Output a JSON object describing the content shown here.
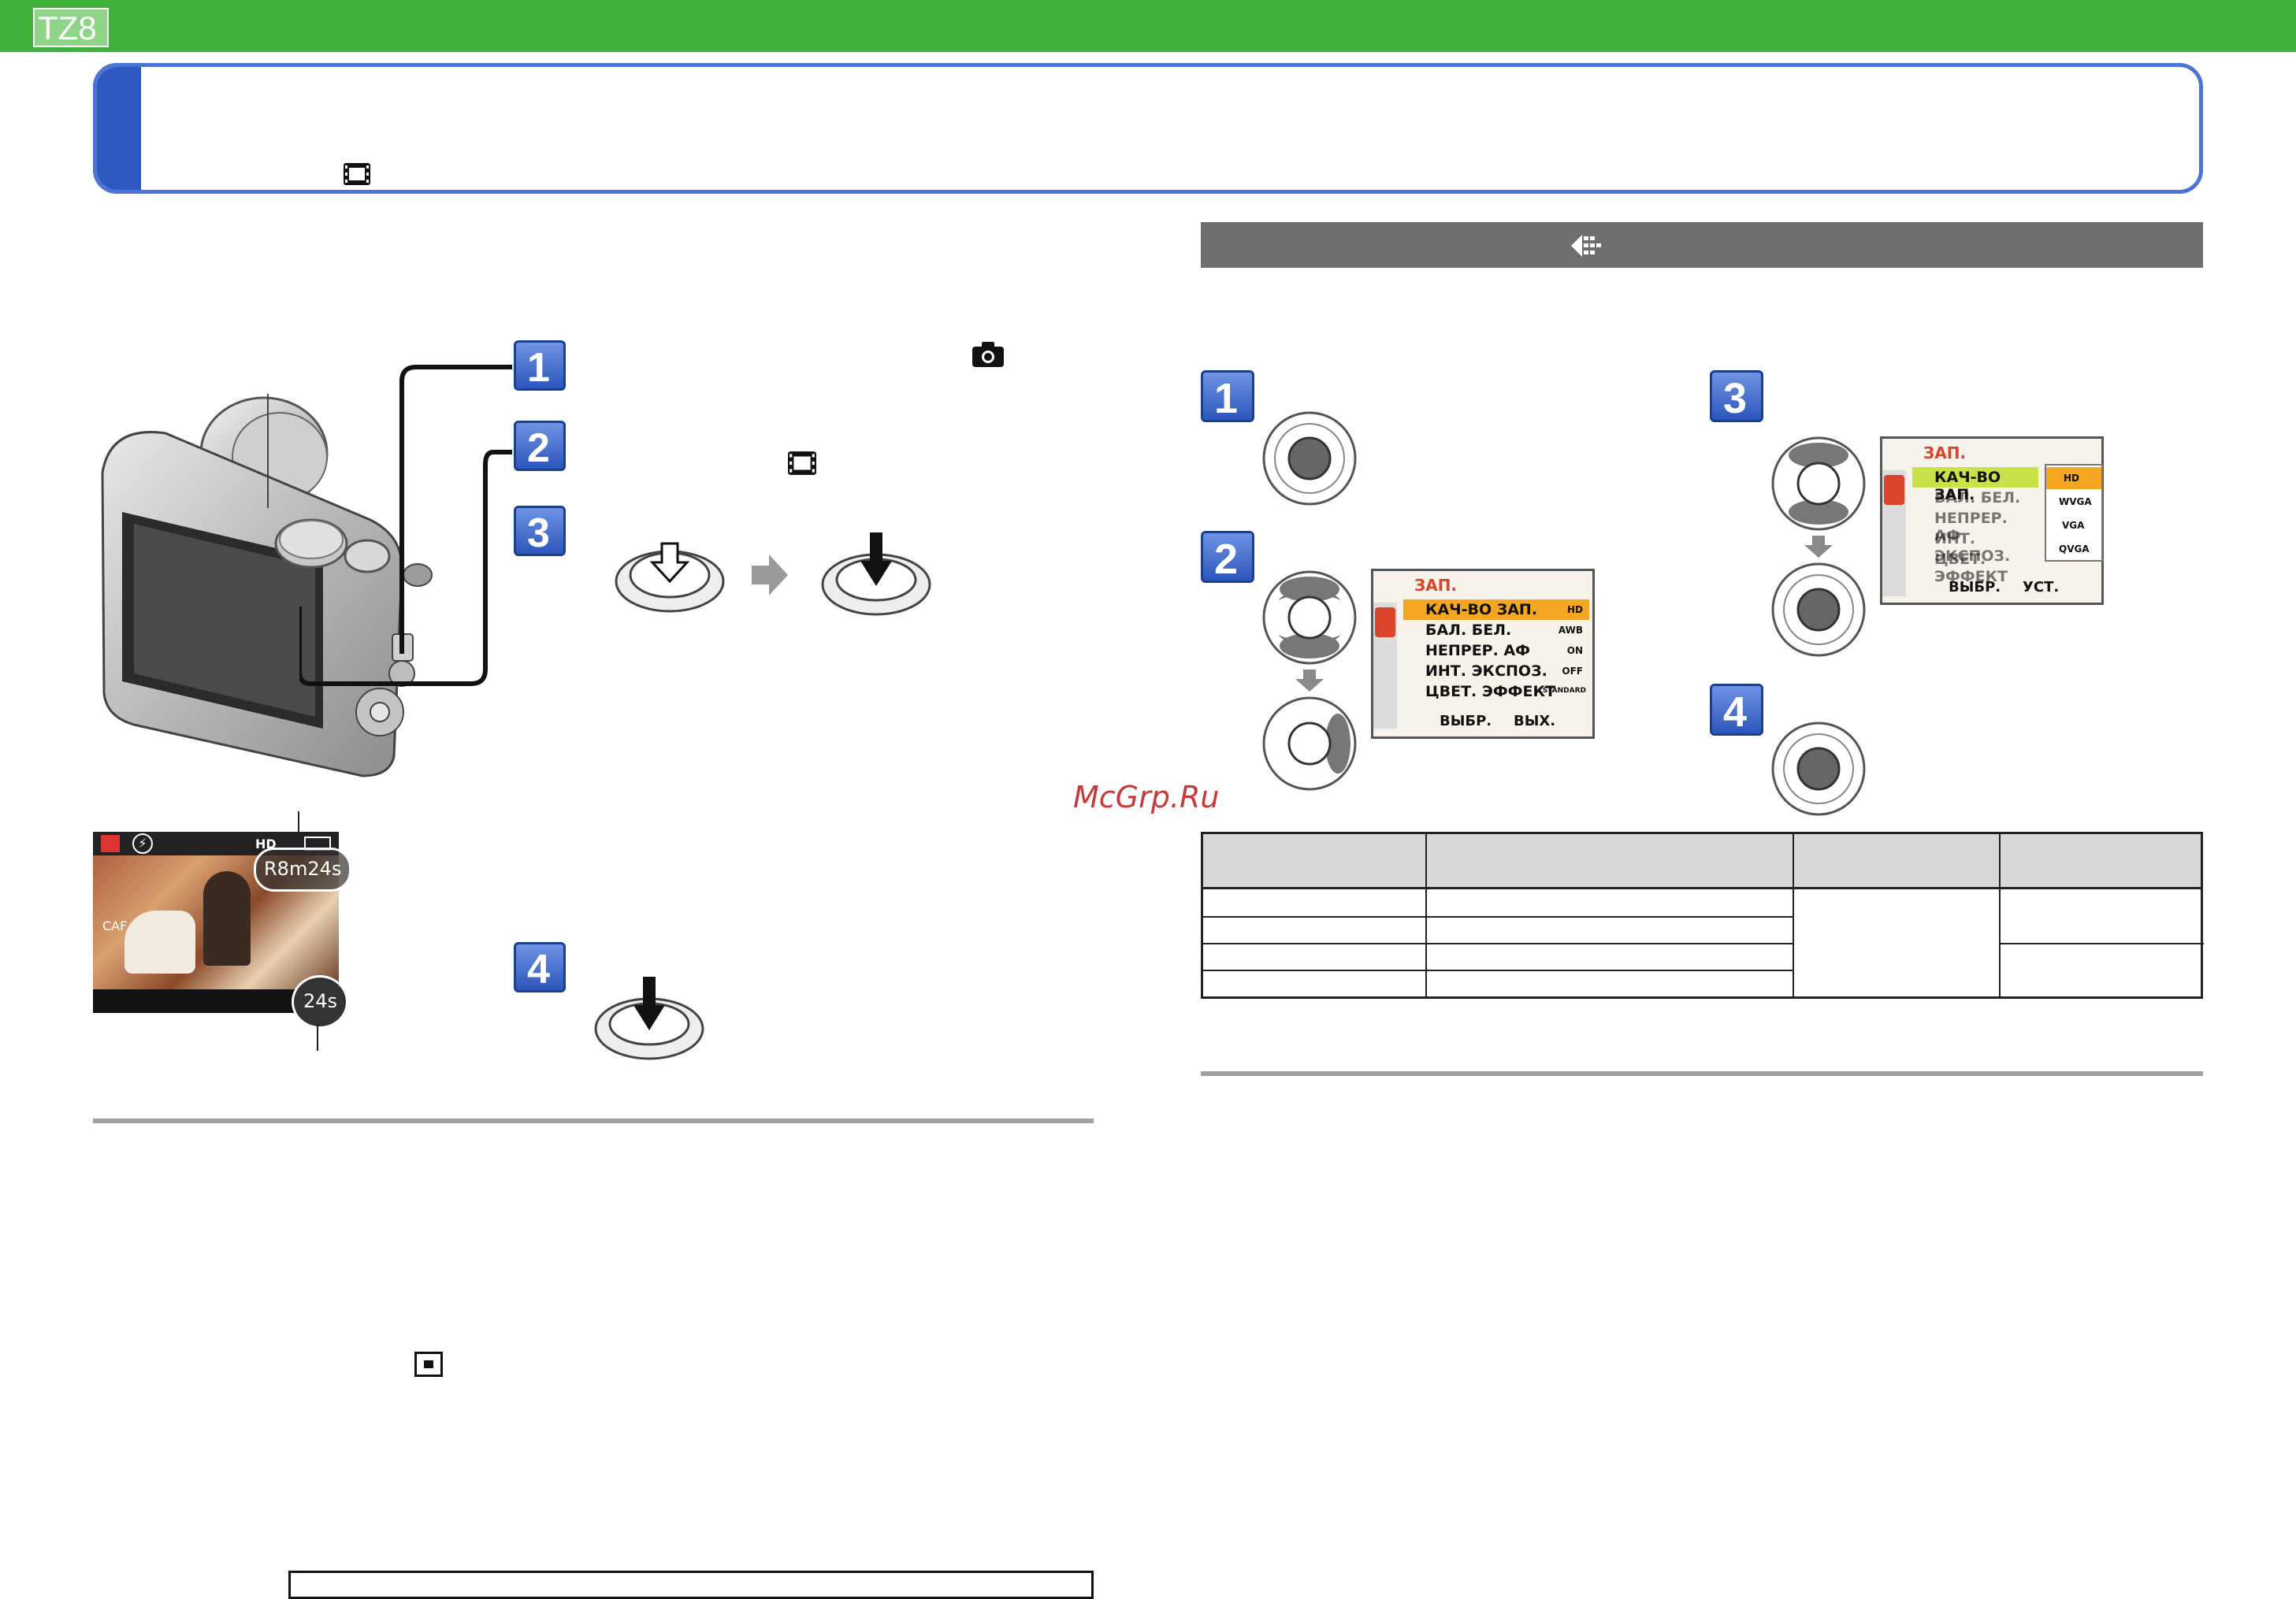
{
  "header": {
    "model_badge": "TZ8"
  },
  "title_box": {
    "title": "",
    "movie_icon": "movie-icon"
  },
  "section_bar": {
    "icon": "menu-icon"
  },
  "steps": [
    "1",
    "2",
    "3",
    "4"
  ],
  "watermark": "McGrp.Ru",
  "rec_screen": {
    "hd": "HD",
    "remaining_time": "R8m24s",
    "elapsed": "24s",
    "af_label": "CAF",
    "flash_icon": "flash-off-icon"
  },
  "menu1": {
    "title": "ЗАП.",
    "rows": [
      {
        "label": "КАЧ-ВО ЗАП.",
        "value": "HD"
      },
      {
        "label": "БАЛ. БЕЛ.",
        "value": "AWB"
      },
      {
        "label": "НЕПРЕР. АФ",
        "value": "ON"
      },
      {
        "label": "ИНТ. ЭКСПОЗ.",
        "value": "OFF"
      },
      {
        "label": "ЦВЕТ. ЭФФЕКТ",
        "value": "STANDARD"
      }
    ],
    "footer": "ВЫБР.",
    "footer_action": "ВЫХ."
  },
  "menu3": {
    "title": "ЗАП.",
    "rows": [
      {
        "label": "КАЧ-ВО ЗАП."
      },
      {
        "label": "БАЛ. БЕЛ."
      },
      {
        "label": "НЕПРЕР. АФ"
      },
      {
        "label": "ИНТ. ЭКСПОЗ."
      },
      {
        "label": "ЦВЕТ. ЭФФЕКТ"
      }
    ],
    "options": [
      "HD",
      "WVGA",
      "VGA",
      "QVGA"
    ],
    "footer": "ВЫБР.",
    "footer_action": "УСТ."
  },
  "colors": {
    "green": "#3fb23a",
    "blue": "#2f5fc4",
    "grey_bar": "#6e6e6e",
    "highlight": "#f5a623",
    "menu_red": "#d9452b"
  }
}
